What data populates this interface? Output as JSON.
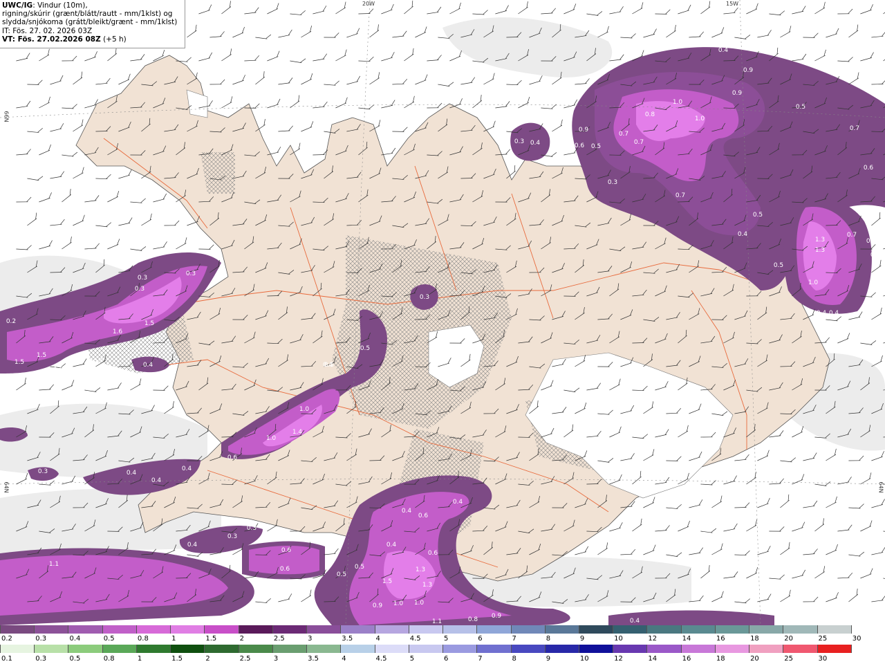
{
  "title": {
    "product": "UWC/IG",
    "description_line1": ": Vindur (10m),",
    "description_line2": "rigning/skúrir (grænt/blátt/rautt - mm/1klst) og",
    "description_line3": "slydda/snjókoma (grátt/bleikt/grænt - mm/1klst)",
    "init_time": "IT: Fös. 27. 02. 2026 03Z",
    "valid_label": "VT: Fös. 27.02.2026 08Z",
    "lead": " (+5 h)"
  },
  "graticule": {
    "lon_20w": "20W",
    "lon_15w": "15W",
    "lat_66n": "66N",
    "lat_65n": "65N",
    "lat_64n_left": "64N",
    "lat_64n_right": "64N"
  },
  "colors": {
    "land": "#f1e2d4",
    "snow": "#ffffff",
    "sea_precip_light": "#eeeeee",
    "road": "#e86a3c",
    "snow_01": "#7d4a85",
    "snow_03": "#8c4e97",
    "snow_05": "#c35dc9",
    "snow_08": "#e37ee9"
  },
  "precip_labels": [
    "0.4",
    "0.9",
    "1.0",
    "0.8",
    "1.0",
    "0.9",
    "0.5",
    "0.7",
    "0.9",
    "0.7",
    "0.7",
    "0.6",
    "0.5",
    "0.3",
    "0.4",
    "0.3",
    "0.7",
    "0.5",
    "0.4",
    "0.6",
    "1.3",
    "1.3",
    "0.7",
    "0.9",
    "0.8",
    "1.0",
    "0.5",
    "0.4",
    "0.4",
    "0.6",
    "0.3",
    "0.3",
    "0.3",
    "0.3",
    "0.2",
    "1.5",
    "1.6",
    "1.5",
    "1.5",
    "0.4",
    "0.6",
    "0.7",
    "0.4",
    "0.5",
    "0.5",
    "1.0",
    "1.4",
    "1.0",
    "0.6",
    "0.3",
    "0.4",
    "0.4",
    "0.4",
    "0.3",
    "0.3",
    "0.4",
    "1.1",
    "0.6",
    "0.6",
    "0.6",
    "0.4",
    "0.4",
    "0.6",
    "0.4",
    "0.6",
    "0.5",
    "1.5",
    "1.3",
    "1.3",
    "0.5",
    "0.9",
    "1.0",
    "1.0",
    "0.9",
    "0.8",
    "1.3",
    "1.1",
    "0.4",
    "0.4"
  ],
  "legend": {
    "snow_scale": {
      "labels": [
        "0.2",
        "0.3",
        "0.4",
        "0.5",
        "0.8",
        "1",
        "1.5",
        "2",
        "2.5",
        "3",
        "3.5",
        "4",
        "4.5",
        "5",
        "6",
        "7",
        "8",
        "9",
        "10",
        "12",
        "14",
        "16",
        "18",
        "20",
        "25",
        "30"
      ],
      "colors": [
        "#7a4a80",
        "#8c5298",
        "#a05cb0",
        "#c060c8",
        "#d76ad8",
        "#e07ee4",
        "#c84fc8",
        "#5a1a5a",
        "#6b2a75",
        "#8a4e9a",
        "#9b80c8",
        "#b6a6e0",
        "#c8c8f0",
        "#b6c0e8",
        "#8fa6d8",
        "#7088b8",
        "#5a7898",
        "#2f4a5c",
        "#356070",
        "#4a7880",
        "#5a8a90",
        "#6a9898",
        "#88a8a8",
        "#a0b8b8",
        "#c8d0d0",
        "#ffffff"
      ]
    },
    "rain_scale": {
      "labels": [
        "0.1",
        "0.3",
        "0.5",
        "0.8",
        "1",
        "1.5",
        "2",
        "2.5",
        "3",
        "3.5",
        "4",
        "4.5",
        "5",
        "6",
        "7",
        "8",
        "9",
        "10",
        "12",
        "14",
        "16",
        "18",
        "20",
        "25",
        "30"
      ],
      "colors": [
        "#e6f4e0",
        "#b8e0a8",
        "#8ccc7c",
        "#5aa858",
        "#2f7a2f",
        "#0f4f0f",
        "#2e6a30",
        "#4a8a4a",
        "#6a9e70",
        "#8ab890",
        "#b8d0e8",
        "#dcdcf8",
        "#c8c8f0",
        "#9a9ae0",
        "#7070d0",
        "#4848c0",
        "#2828a8",
        "#10109a",
        "#6838b0",
        "#9a58c8",
        "#c878d8",
        "#e898e0",
        "#f0a0c0",
        "#f05870",
        "#e82020",
        "#ffffff"
      ]
    }
  }
}
